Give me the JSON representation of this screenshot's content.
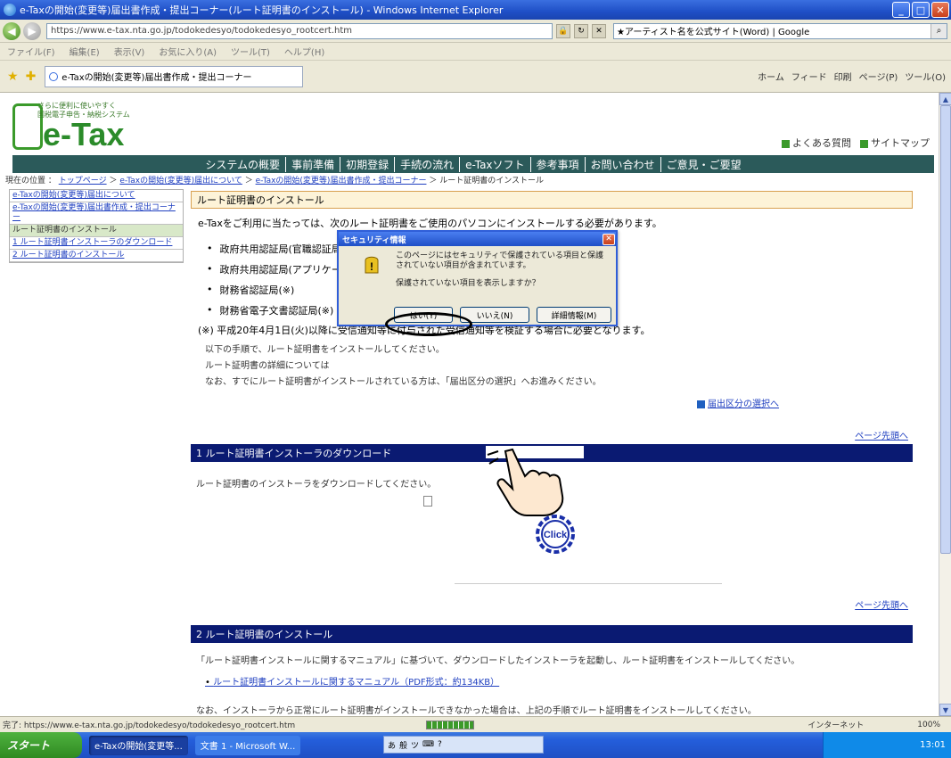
{
  "window": {
    "title": "e-Taxの開始(変更等)届出書作成・提出コーナー(ルート証明書のインストール) - Windows Internet Explorer",
    "min": "_",
    "max": "□",
    "close": "✕"
  },
  "browser": {
    "address": "https://www.e-tax.nta.go.jp/todokedesyo/todokedesyo_rootcert.htm",
    "search_text": "★アーティスト名を公式サイト(Word) | Google",
    "menu": [
      "ファイル(F)",
      "編集(E)",
      "表示(V)",
      "お気に入り(A)",
      "ツール(T)",
      "ヘルプ(H)"
    ],
    "tab_label": "e-Taxの開始(変更等)届出書作成・提出コーナー",
    "command_bar": [
      "ホーム",
      "フィード",
      "印刷",
      "ページ(P)",
      "ツール(O)"
    ]
  },
  "site": {
    "logo_tagline": "さらに便利に使いやすく\n国税電子申告・納税システム",
    "logo_text": "e-Tax",
    "top_links": [
      "よくある質問",
      "サイトマップ"
    ],
    "global_nav": [
      "システムの概要",
      "事前準備",
      "初期登録",
      "手続の流れ",
      "e-Taxソフト",
      "参考事項",
      "お問い合わせ",
      "ご意見・ご要望"
    ],
    "breadcrumb_prefix": "現在の位置 ：",
    "breadcrumb": [
      "トップページ",
      "e-Taxの開始(変更等)届出について",
      "e-Taxの開始(変更等)届出書作成・提出コーナー",
      "ルート証明書のインストール"
    ],
    "side_nav": [
      "e-Taxの開始(変更等)届出について",
      "e-Taxの開始(変更等)届出書作成・提出コーナー",
      "ルート証明書のインストール",
      "1 ルート証明書インストーラのダウンロード",
      "2 ルート証明書のインストール"
    ]
  },
  "main": {
    "section_title": "ルート証明書のインストール",
    "intro": "e-Taxをご利用に当たっては、次のルート証明書をご使用のパソコンにインストールする必要があります。",
    "cert_list": [
      "政府共用認証局(官職認証局)",
      "政府共用認証局(アプリケーション認証局)",
      "財務省認証局(※)",
      "財務省電子文書認証局(※)"
    ],
    "note": "(※) 平成20年4月1日(火)以降に受信通知等に付与された受信通知等を検証する場合に必要となります。",
    "p2_lines": [
      "以下の手順で、ルート証明書をインストールしてください。",
      "ルート証明書の詳細については",
      "なお、すでにルート証明書がインストールされている方は、「届出区分の選択」へお進みください。"
    ],
    "select_link": "届出区分の選択へ",
    "to_top": "ページ先頭へ",
    "section1": "1  ルート証明書インストーラのダウンロード",
    "section1_text": "ルート証明書のインストーラをダウンロードしてください。",
    "section2": "2  ルート証明書のインストール",
    "section2_text": "「ルート証明書インストールに関するマニュアル」に基づいて、ダウンロードしたインストーラを起動し、ルート証明書をインストールしてください。",
    "manual_link": "ルート証明書インストールに関するマニュアル（PDF形式：約134KB）",
    "section2_text2": "なお、インストーラから正常にルート証明書がインストールできなかった場合は、上記の手順でルート証明書をインストールしてください。",
    "click_badge": "Click"
  },
  "dialog": {
    "title": "セキュリティ情報",
    "close": "✕",
    "message": "このページにはセキュリティで保護されている項目と保護されていない項目が含まれています。",
    "question": "保護されていない項目を表示しますか？",
    "buttons": [
      "はい(Y)",
      "いいえ(N)",
      "詳細情報(M)"
    ]
  },
  "statusbar": {
    "text": "完了: https://www.e-tax.nta.go.jp/todokedesyo/todokedesyo_rootcert.htm",
    "progress": 1.0,
    "zone": "インターネット",
    "zoom": "100%"
  },
  "taskbar": {
    "start": "スタート",
    "tasks": [
      "e-Taxの開始(変更等...",
      "文書 1 - Microsoft W..."
    ],
    "clock": "13:01"
  },
  "colors": {
    "nav_bg": "#2b5a5a",
    "section_bar": "#0a1a72",
    "logo_green": "#2b8b2a",
    "link_blue": "#2040c0"
  }
}
